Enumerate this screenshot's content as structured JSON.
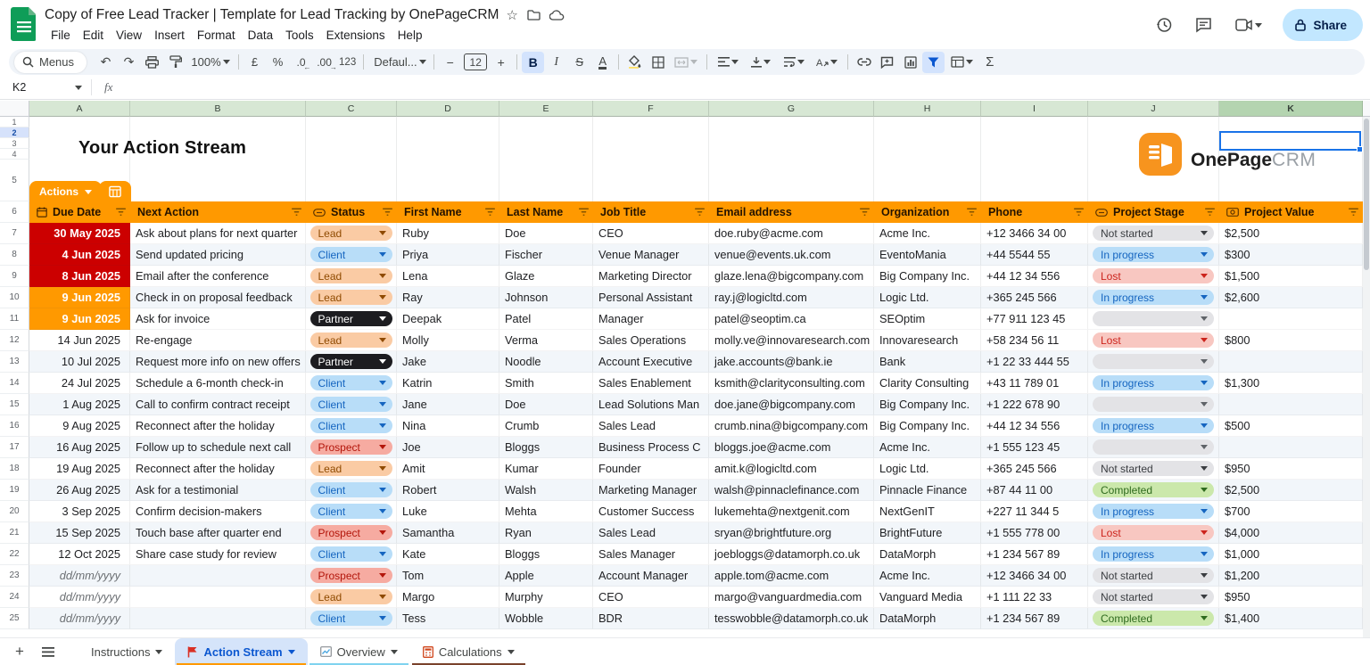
{
  "titlebar": {
    "doc_title": "Copy of Free Lead Tracker | Template for Lead Tracking by OnePageCRM",
    "menu_items": [
      "File",
      "Edit",
      "View",
      "Insert",
      "Format",
      "Data",
      "Tools",
      "Extensions",
      "Help"
    ],
    "share_label": "Share"
  },
  "toolbar": {
    "menus_label": "Menus",
    "zoom_value": "100%",
    "currency": "£",
    "percent": "%",
    "decimal_decrease": ".0",
    "decimal_increase": ".00",
    "more_formats": "123",
    "font_name": "Defaul...",
    "font_size": "12",
    "bold": "B",
    "italic": "I",
    "strikethrough": "S",
    "text_color": "A",
    "functions": "Σ"
  },
  "formula_bar": {
    "cell_reference": "K2",
    "fx_label": "fx"
  },
  "selection": {
    "cell": "K2",
    "column": "K",
    "row": 2
  },
  "column_letters": [
    "A",
    "B",
    "C",
    "D",
    "E",
    "F",
    "G",
    "H",
    "I",
    "J",
    "K"
  ],
  "row_numbers": [
    1,
    2,
    3,
    4,
    5,
    6,
    7,
    8,
    9,
    10,
    11,
    12,
    13,
    14,
    15,
    16,
    17,
    18,
    19,
    20,
    21,
    22,
    23,
    24,
    25
  ],
  "sheet": {
    "page_title": "Your Action Stream",
    "actions_tab_label": "Actions",
    "logo_text_bold": "OnePage",
    "logo_text_light": "CRM",
    "table": {
      "headers": [
        {
          "label": "Due Date",
          "icon": "calendar"
        },
        {
          "label": "Next Action",
          "icon": null
        },
        {
          "label": "Status",
          "icon": "chip"
        },
        {
          "label": "First Name",
          "icon": null
        },
        {
          "label": "Last Name",
          "icon": null
        },
        {
          "label": "Job Title",
          "icon": null
        },
        {
          "label": "Email address",
          "icon": null
        },
        {
          "label": "Organization",
          "icon": null
        },
        {
          "label": "Phone",
          "icon": null
        },
        {
          "label": "Project Stage",
          "icon": "chip"
        },
        {
          "label": "Project Value",
          "icon": "coin"
        }
      ],
      "rows": [
        {
          "n": 7,
          "due": "30 May 2025",
          "due_variant": "overdue",
          "action": "Ask about plans for next quarter",
          "status": {
            "label": "Lead",
            "variant": "lead"
          },
          "first": "Ruby",
          "last": "Doe",
          "job": "CEO",
          "email": "doe.ruby@acme.com",
          "org": "Acme Inc.",
          "phone": "+12 3466 34 00",
          "stage": {
            "label": "Not started",
            "variant": "notstarted"
          },
          "value": "$2,500"
        },
        {
          "n": 8,
          "due": "4 Jun 2025",
          "due_variant": "overdue",
          "action": "Send updated pricing",
          "status": {
            "label": "Client",
            "variant": "client"
          },
          "first": "Priya",
          "last": "Fischer",
          "job": "Venue Manager",
          "email": "venue@events.uk.com",
          "org": "EventoMania",
          "phone": "+44 5544 55",
          "stage": {
            "label": "In progress",
            "variant": "inprogress"
          },
          "value": "$300"
        },
        {
          "n": 9,
          "due": "8 Jun 2025",
          "due_variant": "overdue",
          "action": "Email after the conference",
          "status": {
            "label": "Lead",
            "variant": "lead"
          },
          "first": "Lena",
          "last": "Glaze",
          "job": "Marketing Director",
          "email": "glaze.lena@bigcompany.com",
          "org": "Big Company Inc.",
          "phone": "+44 12 34 556",
          "stage": {
            "label": "Lost",
            "variant": "lost"
          },
          "value": "$1,500"
        },
        {
          "n": 10,
          "due": "9 Jun 2025",
          "due_variant": "today",
          "action": "Check in on proposal feedback",
          "status": {
            "label": "Lead",
            "variant": "lead"
          },
          "first": "Ray",
          "last": "Johnson",
          "job": "Personal Assistant",
          "email": "ray.j@logicltd.com",
          "org": "Logic Ltd.",
          "phone": "+365 245 566",
          "stage": {
            "label": "In progress",
            "variant": "inprogress"
          },
          "value": "$2,600"
        },
        {
          "n": 11,
          "due": "9 Jun 2025",
          "due_variant": "today",
          "action": "Ask for invoice",
          "status": {
            "label": "Partner",
            "variant": "partner"
          },
          "first": "Deepak",
          "last": "Patel",
          "job": "Manager",
          "email": "patel@seoptim.ca",
          "org": "SEOptim",
          "phone": "+77 911 123 45",
          "stage": {
            "label": "",
            "variant": "empty"
          },
          "value": ""
        },
        {
          "n": 12,
          "due": "14 Jun 2025",
          "due_variant": "normal",
          "action": "Re-engage",
          "status": {
            "label": "Lead",
            "variant": "lead"
          },
          "first": "Molly",
          "last": "Verma",
          "job": "Sales Operations",
          "email": "molly.ve@innovaresearch.com",
          "org": "Innovaresearch",
          "phone": "+58 234 56 11",
          "stage": {
            "label": "Lost",
            "variant": "lost"
          },
          "value": "$800"
        },
        {
          "n": 13,
          "due": "10 Jul 2025",
          "due_variant": "normal",
          "action": "Request more info on new offers",
          "status": {
            "label": "Partner",
            "variant": "partner"
          },
          "first": "Jake",
          "last": "Noodle",
          "job": "Account Executive",
          "email": "jake.accounts@bank.ie",
          "org": "Bank",
          "phone": "+1 22 33 444 55",
          "stage": {
            "label": "",
            "variant": "empty"
          },
          "value": ""
        },
        {
          "n": 14,
          "due": "24 Jul 2025",
          "due_variant": "normal",
          "action": "Schedule a 6-month check-in",
          "status": {
            "label": "Client",
            "variant": "client"
          },
          "first": "Katrin",
          "last": "Smith",
          "job": "Sales Enablement",
          "email": "ksmith@clarityconsulting.com",
          "org": "Clarity Consulting",
          "phone": "+43 11 789 01",
          "stage": {
            "label": "In progress",
            "variant": "inprogress"
          },
          "value": "$1,300"
        },
        {
          "n": 15,
          "due": "1 Aug 2025",
          "due_variant": "normal",
          "action": "Call to confirm contract receipt",
          "status": {
            "label": "Client",
            "variant": "client"
          },
          "first": "Jane",
          "last": "Doe",
          "job": "Lead Solutions Man",
          "email": "doe.jane@bigcompany.com",
          "org": "Big Company Inc.",
          "phone": "+1 222 678 90",
          "stage": {
            "label": "",
            "variant": "empty"
          },
          "value": ""
        },
        {
          "n": 16,
          "due": "9 Aug 2025",
          "due_variant": "normal",
          "action": "Reconnect after the holiday",
          "status": {
            "label": "Client",
            "variant": "client"
          },
          "first": "Nina",
          "last": "Crumb",
          "job": "Sales Lead",
          "email": "crumb.nina@bigcompany.com",
          "org": "Big Company Inc.",
          "phone": "+44 12 34 556",
          "stage": {
            "label": "In progress",
            "variant": "inprogress"
          },
          "value": "$500"
        },
        {
          "n": 17,
          "due": "16 Aug 2025",
          "due_variant": "normal",
          "action": "Follow up to schedule next call",
          "status": {
            "label": "Prospect",
            "variant": "prospect"
          },
          "first": "Joe",
          "last": "Bloggs",
          "job": "Business Process C",
          "email": "bloggs.joe@acme.com",
          "org": "Acme Inc.",
          "phone": "+1 555 123 45",
          "stage": {
            "label": "",
            "variant": "empty"
          },
          "value": ""
        },
        {
          "n": 18,
          "due": "19 Aug 2025",
          "due_variant": "normal",
          "action": "Reconnect after the holiday",
          "status": {
            "label": "Lead",
            "variant": "lead"
          },
          "first": "Amit",
          "last": "Kumar",
          "job": "Founder",
          "email": "amit.k@logicltd.com",
          "org": "Logic Ltd.",
          "phone": "+365 245 566",
          "stage": {
            "label": "Not started",
            "variant": "notstarted"
          },
          "value": "$950"
        },
        {
          "n": 19,
          "due": "26 Aug 2025",
          "due_variant": "normal",
          "action": "Ask for a testimonial",
          "status": {
            "label": "Client",
            "variant": "client"
          },
          "first": "Robert",
          "last": "Walsh",
          "job": "Marketing Manager",
          "email": "walsh@pinnaclefinance.com",
          "org": "Pinnacle Finance",
          "phone": "+87 44 11 00",
          "stage": {
            "label": "Completed",
            "variant": "completed"
          },
          "value": "$2,500"
        },
        {
          "n": 20,
          "due": "3 Sep 2025",
          "due_variant": "normal",
          "action": "Confirm decision-makers",
          "status": {
            "label": "Client",
            "variant": "client"
          },
          "first": "Luke",
          "last": "Mehta",
          "job": "Customer Success",
          "email": "lukemehta@nextgenit.com",
          "org": "NextGenIT",
          "phone": "+227 11 344 5",
          "stage": {
            "label": "In progress",
            "variant": "inprogress"
          },
          "value": "$700"
        },
        {
          "n": 21,
          "due": "15 Sep 2025",
          "due_variant": "normal",
          "action": "Touch base after quarter end",
          "status": {
            "label": "Prospect",
            "variant": "prospect"
          },
          "first": "Samantha",
          "last": "Ryan",
          "job": "Sales Lead",
          "email": "sryan@brightfuture.org",
          "org": "BrightFuture",
          "phone": "+1 555 778 00",
          "stage": {
            "label": "Lost",
            "variant": "lost"
          },
          "value": "$4,000"
        },
        {
          "n": 22,
          "due": "12 Oct 2025",
          "due_variant": "normal",
          "action": "Share case study for review",
          "status": {
            "label": "Client",
            "variant": "client"
          },
          "first": "Kate",
          "last": "Bloggs",
          "job": "Sales Manager",
          "email": "joebloggs@datamorph.co.uk",
          "org": "DataMorph",
          "phone": "+1 234 567 89",
          "stage": {
            "label": "In progress",
            "variant": "inprogress"
          },
          "value": "$1,000"
        },
        {
          "n": 23,
          "due": "dd/mm/yyyy",
          "due_variant": "placeholder",
          "action": "",
          "status": {
            "label": "Prospect",
            "variant": "prospect"
          },
          "first": "Tom",
          "last": "Apple",
          "job": "Account Manager",
          "email": "apple.tom@acme.com",
          "org": "Acme Inc.",
          "phone": "+12 3466 34 00",
          "stage": {
            "label": "Not started",
            "variant": "notstarted"
          },
          "value": "$1,200"
        },
        {
          "n": 24,
          "due": "dd/mm/yyyy",
          "due_variant": "placeholder",
          "action": "",
          "status": {
            "label": "Lead",
            "variant": "lead"
          },
          "first": "Margo",
          "last": "Murphy",
          "job": "CEO",
          "email": "margo@vanguardmedia.com",
          "org": "Vanguard Media",
          "phone": "+1 111 22 33",
          "stage": {
            "label": "Not started",
            "variant": "notstarted"
          },
          "value": "$950"
        },
        {
          "n": 25,
          "due": "dd/mm/yyyy",
          "due_variant": "placeholder",
          "action": "",
          "status": {
            "label": "Client",
            "variant": "client"
          },
          "first": "Tess",
          "last": "Wobble",
          "job": "BDR",
          "email": "tesswobble@datamorph.co.uk",
          "org": "DataMorph",
          "phone": "+1 234 567 89",
          "stage": {
            "label": "Completed",
            "variant": "completed"
          },
          "value": "$1,400"
        }
      ]
    }
  },
  "sheet_tabs": {
    "items": [
      {
        "label": "Instructions",
        "active": false,
        "icon": null,
        "strip": null
      },
      {
        "label": "Action Stream",
        "active": true,
        "icon": "flag",
        "strip": "#FF9900"
      },
      {
        "label": "Overview",
        "active": false,
        "icon": "chart",
        "strip": "#7FD3EF"
      },
      {
        "label": "Calculations",
        "active": false,
        "icon": "calculator",
        "strip": "#79422B"
      }
    ]
  },
  "colors": {
    "accent_orange": "#FF9900",
    "overdue_red": "#CC0000",
    "selection_blue": "#1A73E8",
    "share_bg": "#C2E7FF",
    "share_text": "#041E49",
    "toolbar_bg": "#F0F4F9",
    "active_icon_bg": "#D3E3FD",
    "col_header_green": "#D7E7D4",
    "col_header_green_selected": "#B4D4B0",
    "banding_light": "#F2F6FA",
    "pill_lead_bg": "#FACBA4",
    "pill_lead_text": "#8F4A00",
    "pill_client_bg": "#B8DDF8",
    "pill_client_text": "#1565C0",
    "pill_partner_bg": "#1C1C20",
    "pill_prospect_bg": "#F6ABA1",
    "pill_prospect_text": "#B3160B",
    "stage_not_started_bg": "#E3E3E6",
    "stage_not_started_text": "#3A3D41",
    "stage_in_progress_bg": "#B8DDF8",
    "stage_in_progress_text": "#1565C0",
    "stage_lost_bg": "#F8C7C1",
    "stage_lost_text": "#CC241D",
    "stage_completed_bg": "#CBE8AB",
    "stage_completed_text": "#2F6B1F",
    "stage_empty_bg": "#E3E3E6",
    "logo_orange": "#F7941E",
    "tab_active_bg": "#D5E4FA",
    "tab_active_text": "#0B57D0",
    "flag_red": "#D93025",
    "sheets_green": "#0F9D58"
  }
}
